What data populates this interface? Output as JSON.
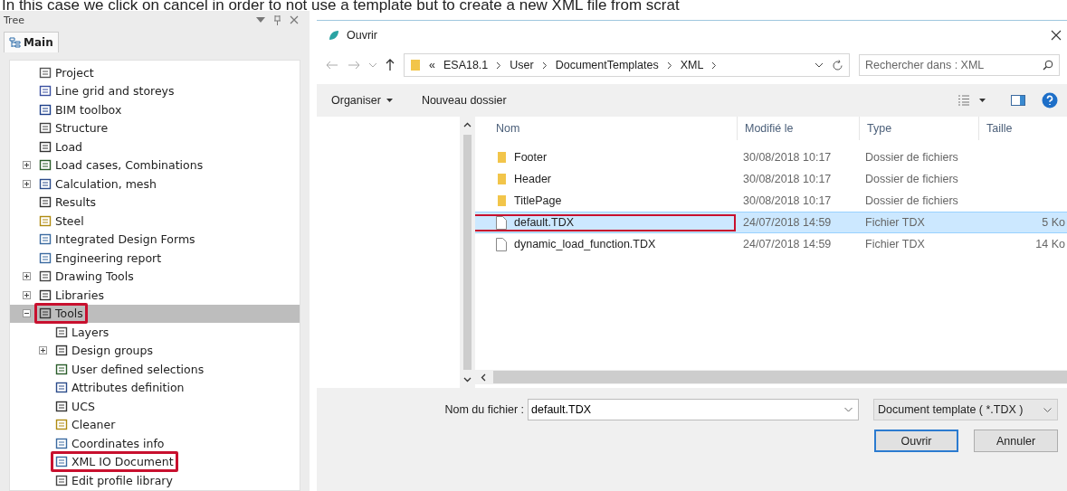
{
  "caption": "In this case we click on cancel in order to not use a template but to create a new XML file from scrat",
  "tree_panel": {
    "title": "Tree",
    "tabs": [
      {
        "label": "Main",
        "selected": true
      }
    ],
    "items": [
      {
        "label": "Project",
        "selected": false,
        "highlighted": false
      },
      {
        "label": "Line grid and storeys",
        "selected": false,
        "highlighted": false
      },
      {
        "label": "BIM toolbox",
        "selected": false,
        "highlighted": false
      },
      {
        "label": "Structure",
        "selected": false,
        "highlighted": false
      },
      {
        "label": "Load",
        "selected": false,
        "highlighted": false
      },
      {
        "label": "Load cases, Combinations",
        "expanded": false,
        "selected": false,
        "highlighted": false
      },
      {
        "label": "Calculation, mesh",
        "expanded": false,
        "selected": false,
        "highlighted": false
      },
      {
        "label": "Results",
        "selected": false,
        "highlighted": false
      },
      {
        "label": "Steel",
        "selected": false,
        "highlighted": false
      },
      {
        "label": "Integrated Design Forms",
        "selected": false,
        "highlighted": false
      },
      {
        "label": "Engineering report",
        "selected": false,
        "highlighted": false
      },
      {
        "label": "Drawing Tools",
        "expanded": false,
        "selected": false,
        "highlighted": false
      },
      {
        "label": "Libraries",
        "expanded": false,
        "selected": false,
        "highlighted": false
      },
      {
        "label": "Tools",
        "expanded": true,
        "selected": true,
        "highlighted": true,
        "children": [
          {
            "label": "Layers",
            "selected": false,
            "highlighted": false
          },
          {
            "label": "Design groups",
            "expanded": false,
            "selected": false,
            "highlighted": false
          },
          {
            "label": "User defined selections",
            "selected": false,
            "highlighted": false
          },
          {
            "label": "Attributes definition",
            "selected": false,
            "highlighted": false
          },
          {
            "label": "UCS",
            "selected": false,
            "highlighted": false
          },
          {
            "label": "Cleaner",
            "selected": false,
            "highlighted": false
          },
          {
            "label": "Coordinates info",
            "selected": false,
            "highlighted": false
          },
          {
            "label": "XML IO Document",
            "selected": false,
            "highlighted": true
          },
          {
            "label": "Edit profile library",
            "selected": false,
            "highlighted": false
          }
        ]
      }
    ]
  },
  "dialog": {
    "title": "Ouvrir",
    "breadcrumb": [
      "«",
      "ESA18.1",
      "User",
      "DocumentTemplates",
      "XML"
    ],
    "search": {
      "placeholder": "Rechercher dans : XML"
    },
    "toolbar": [
      "Organiser",
      "Nouveau dossier"
    ],
    "columns": [
      "Nom",
      "Modifié le",
      "Type",
      "Taille"
    ],
    "files": [
      {
        "kind": "folder",
        "name": "Footer",
        "modified": "30/08/2018 10:17",
        "type": "Dossier de fichiers",
        "selected": false,
        "highlighted": false
      },
      {
        "kind": "folder",
        "name": "Header",
        "modified": "30/08/2018 10:17",
        "type": "Dossier de fichiers",
        "selected": false,
        "highlighted": false
      },
      {
        "kind": "folder",
        "name": "TitlePage",
        "modified": "30/08/2018 10:17",
        "type": "Dossier de fichiers",
        "selected": false,
        "highlighted": false
      },
      {
        "kind": "file",
        "name": "default.TDX",
        "modified": "24/07/2018 14:59",
        "type": "Fichier TDX",
        "size": "5 Ko",
        "selected": true,
        "highlighted": true
      },
      {
        "kind": "file",
        "name": "dynamic_load_function.TDX",
        "modified": "24/07/2018 14:59",
        "type": "Fichier TDX",
        "size": "14 Ko",
        "selected": false,
        "highlighted": false
      }
    ],
    "filename_label": "Nom du fichier :",
    "filename": "default.TDX",
    "filter": "Document template ( *.TDX )",
    "buttons": [
      {
        "label": "Ouvrir",
        "kind": "primary"
      },
      {
        "label": "Annuler",
        "kind": "normal"
      }
    ]
  }
}
